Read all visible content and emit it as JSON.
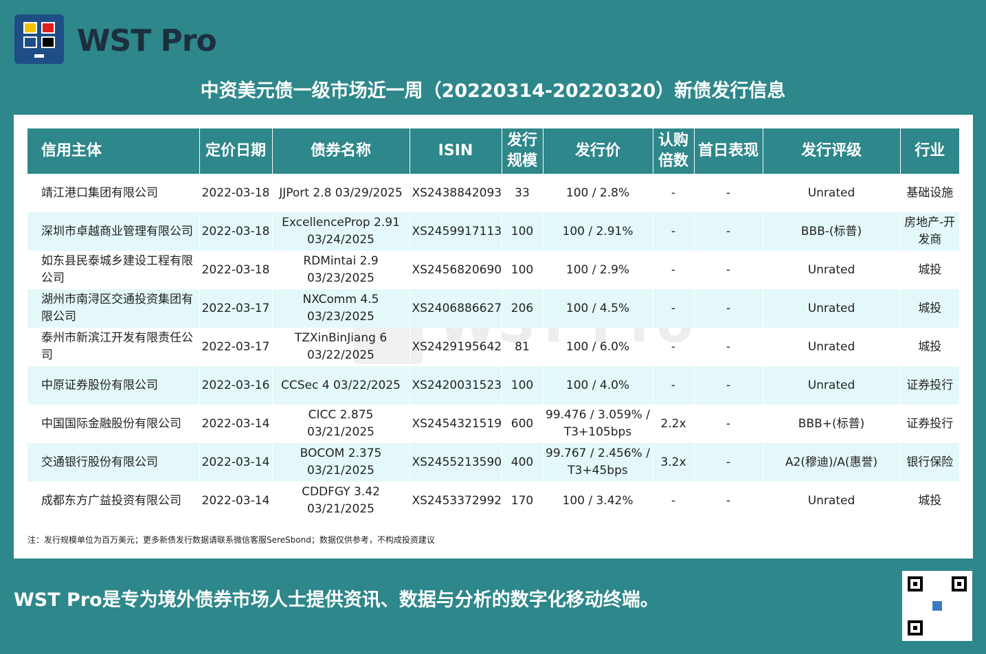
{
  "header": {
    "brand": "WST Pro",
    "logo_icon": "wst-pro-logo-icon",
    "logo_colors": [
      "#f2c200",
      "#e0201f",
      "#1f4e86",
      "#000000"
    ]
  },
  "title": "中资美元债一级市场近一周（20220314-20220320）新债发行信息",
  "table": {
    "columns": [
      "信用主体",
      "定价日期",
      "债券名称",
      "ISIN",
      "发行规模",
      "发行价",
      "认购倍数",
      "首日表现",
      "发行评级",
      "行业"
    ],
    "rows": [
      {
        "issuer": "靖江港口集团有限公司",
        "date": "2022-03-18",
        "bond": "JJPort 2.8 03/29/2025",
        "isin": "XS2438842093",
        "size": "33",
        "price": "100 / 2.8%",
        "subscription": "-",
        "first_day": "-",
        "rating": "Unrated",
        "industry": "基础设施"
      },
      {
        "issuer": "深圳市卓越商业管理有限公司",
        "date": "2022-03-18",
        "bond": "ExcellenceProp 2.91 03/24/2025",
        "isin": "XS2459917113",
        "size": "100",
        "price": "100 / 2.91%",
        "subscription": "-",
        "first_day": "-",
        "rating": "BBB-(标普)",
        "industry": "房地产-开发商"
      },
      {
        "issuer": "如东县民泰城乡建设工程有限公司",
        "date": "2022-03-18",
        "bond": "RDMintai 2.9 03/23/2025",
        "isin": "XS2456820690",
        "size": "100",
        "price": "100 / 2.9%",
        "subscription": "-",
        "first_day": "-",
        "rating": "Unrated",
        "industry": "城投"
      },
      {
        "issuer": "湖州市南浔区交通投资集团有限公司",
        "date": "2022-03-17",
        "bond": "NXComm 4.5 03/23/2025",
        "isin": "XS2406886627",
        "size": "206",
        "price": "100 / 4.5%",
        "subscription": "-",
        "first_day": "-",
        "rating": "Unrated",
        "industry": "城投"
      },
      {
        "issuer": "泰州市新滨江开发有限责任公司",
        "date": "2022-03-17",
        "bond": "TZXinBinJiang 6 03/22/2025",
        "isin": "XS2429195642",
        "size": "81",
        "price": "100 / 6.0%",
        "subscription": "-",
        "first_day": "-",
        "rating": "Unrated",
        "industry": "城投"
      },
      {
        "issuer": "中原证券股份有限公司",
        "date": "2022-03-16",
        "bond": "CCSec 4 03/22/2025",
        "isin": "XS2420031523",
        "size": "100",
        "price": "100 / 4.0%",
        "subscription": "-",
        "first_day": "-",
        "rating": "Unrated",
        "industry": "证券投行"
      },
      {
        "issuer": "中国国际金融股份有限公司",
        "date": "2022-03-14",
        "bond": "CICC 2.875 03/21/2025",
        "isin": "XS2454321519",
        "size": "600",
        "price": "99.476 / 3.059% / T3+105bps",
        "subscription": "2.2x",
        "first_day": "-",
        "rating": "BBB+(标普)",
        "industry": "证券投行"
      },
      {
        "issuer": "交通银行股份有限公司",
        "date": "2022-03-14",
        "bond": "BOCOM 2.375 03/21/2025",
        "isin": "XS2455213590",
        "size": "400",
        "price": "99.767 / 2.456% / T3+45bps",
        "subscription": "3.2x",
        "first_day": "-",
        "rating": "A2(穆迪)/A(惠誉)",
        "industry": "银行保险"
      },
      {
        "issuer": "成都东方广益投资有限公司",
        "date": "2022-03-14",
        "bond": "CDDFGY 3.42 03/21/2025",
        "isin": "XS2453372992",
        "size": "170",
        "price": "100 / 3.42%",
        "subscription": "-",
        "first_day": "-",
        "rating": "Unrated",
        "industry": "城投"
      }
    ]
  },
  "watermark": "WST Pro",
  "note": "注：发行规模单位为百万美元；更多新债发行数据请联系微信客服SereSbond；数据仅供参考，不构成投资建议",
  "footer": {
    "slogan": "WST Pro是专为境外债券市场人士提供资讯、数据与分析的数字化移动终端。",
    "qr_icon": "qr-code-icon"
  },
  "colors": {
    "background": "#2e878a",
    "header_row": "#2e878a",
    "alt_row": "#e4f8f9",
    "brand_text": "#1c2f3f"
  }
}
